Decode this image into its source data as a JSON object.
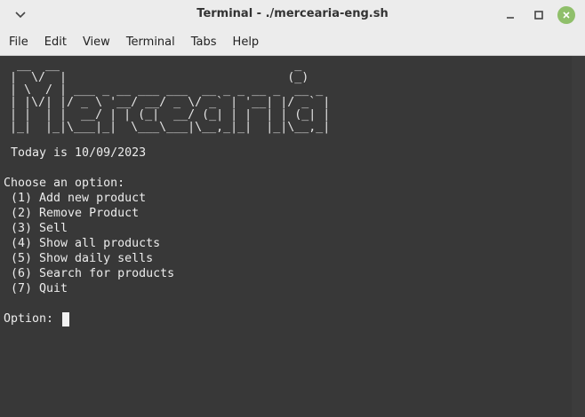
{
  "window": {
    "title": "Terminal - ./mercearia-eng.sh"
  },
  "menubar": {
    "items": [
      "File",
      "Edit",
      "View",
      "Terminal",
      "Tabs",
      "Help"
    ]
  },
  "terminal": {
    "banner": " __  __                                 _\n|  \\/  |                               (_)\n| \\  / | ___ _ __ ___ ___  __ _ _ __ _  __ _\n| |\\/| |/ _ \\ '__/ __/ _ \\/ _` | '__| |/ _` |\n| |  | |  __/ | | (_|  __/ (_| | |  | | (_| |\n|_|  |_|\\___|_|  \\___\\___|\\__,_|_|  |_|\\__,_|",
    "date_line": " Today is 10/09/2023",
    "menu_header": "Choose an option:",
    "options": [
      " (1) Add new product",
      " (2) Remove Product",
      " (3) Sell",
      " (4) Show all products",
      " (5) Show daily sells",
      " (6) Search for products",
      " (7) Quit"
    ],
    "prompt": "Option: "
  },
  "icons": {
    "window_menu": "chevron-down-icon",
    "minimize": "minimize-icon",
    "maximize": "maximize-icon",
    "close": "close-icon"
  },
  "colors": {
    "terminal_bg": "#383838",
    "terminal_fg": "#ececec",
    "titlebar_bg": "#ececec",
    "close_button": "#8fbf6a"
  }
}
